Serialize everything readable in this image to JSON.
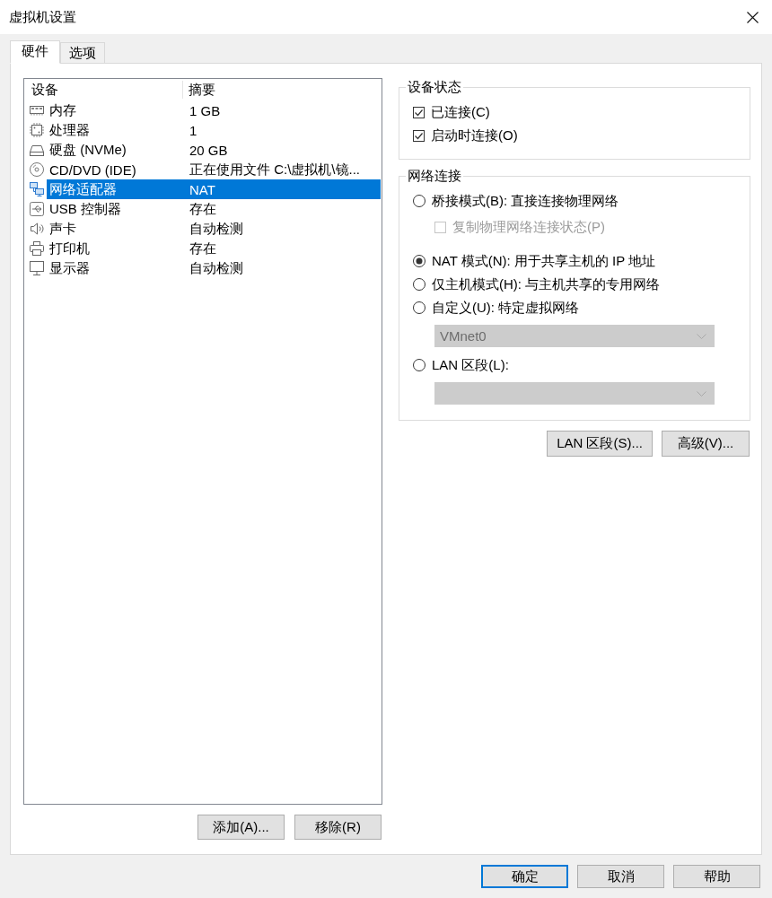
{
  "window": {
    "title": "虚拟机设置"
  },
  "tabs": [
    {
      "label": "硬件",
      "selected": true
    },
    {
      "label": "选项",
      "selected": false
    }
  ],
  "device_list": {
    "columns": [
      "设备",
      "摘要"
    ],
    "rows": [
      {
        "kind": "memory",
        "device": "内存",
        "summary": "1 GB",
        "selected": false
      },
      {
        "kind": "cpu",
        "device": "处理器",
        "summary": "1",
        "selected": false
      },
      {
        "kind": "disk",
        "device": "硬盘 (NVMe)",
        "summary": "20 GB",
        "selected": false
      },
      {
        "kind": "cd",
        "device": "CD/DVD (IDE)",
        "summary": "正在使用文件 C:\\虚拟机\\镜...",
        "selected": false
      },
      {
        "kind": "network",
        "device": "网络适配器",
        "summary": "NAT",
        "selected": true
      },
      {
        "kind": "usb",
        "device": "USB 控制器",
        "summary": "存在",
        "selected": false
      },
      {
        "kind": "sound",
        "device": "声卡",
        "summary": "自动检测",
        "selected": false
      },
      {
        "kind": "printer",
        "device": "打印机",
        "summary": "存在",
        "selected": false
      },
      {
        "kind": "display",
        "device": "显示器",
        "summary": "自动检测",
        "selected": false
      }
    ]
  },
  "list_buttons": [
    "添加(A)...",
    "移除(R)"
  ],
  "device_status": {
    "title": "设备状态",
    "options": [
      {
        "label": "已连接(C)",
        "checked": true
      },
      {
        "label": "启动时连接(O)",
        "checked": true
      }
    ]
  },
  "network_connection": {
    "title": "网络连接",
    "items": [
      {
        "kind": "radio",
        "label": "桥接模式(B): 直接连接物理网络",
        "selected": false
      },
      {
        "kind": "checkbox",
        "label": "复制物理网络连接状态(P)",
        "checked": false,
        "disabled": true
      },
      {
        "kind": "radio",
        "label": "NAT 模式(N): 用于共享主机的 IP 地址",
        "selected": true
      },
      {
        "kind": "radio",
        "label": "仅主机模式(H): 与主机共享的专用网络",
        "selected": false
      },
      {
        "kind": "radio",
        "label": "自定义(U): 特定虚拟网络",
        "selected": false
      },
      {
        "kind": "select",
        "value": "VMnet0",
        "disabled": true
      },
      {
        "kind": "radio",
        "label": "LAN 区段(L):",
        "selected": false
      },
      {
        "kind": "select",
        "disabled": true
      }
    ]
  },
  "network_buttons": [
    "LAN 区段(S)...",
    "高级(V)..."
  ],
  "dialog_buttons": [
    {
      "label": "确定",
      "focused": true
    },
    {
      "label": "取消",
      "focused": false
    },
    {
      "label": "帮助",
      "focused": false
    }
  ]
}
